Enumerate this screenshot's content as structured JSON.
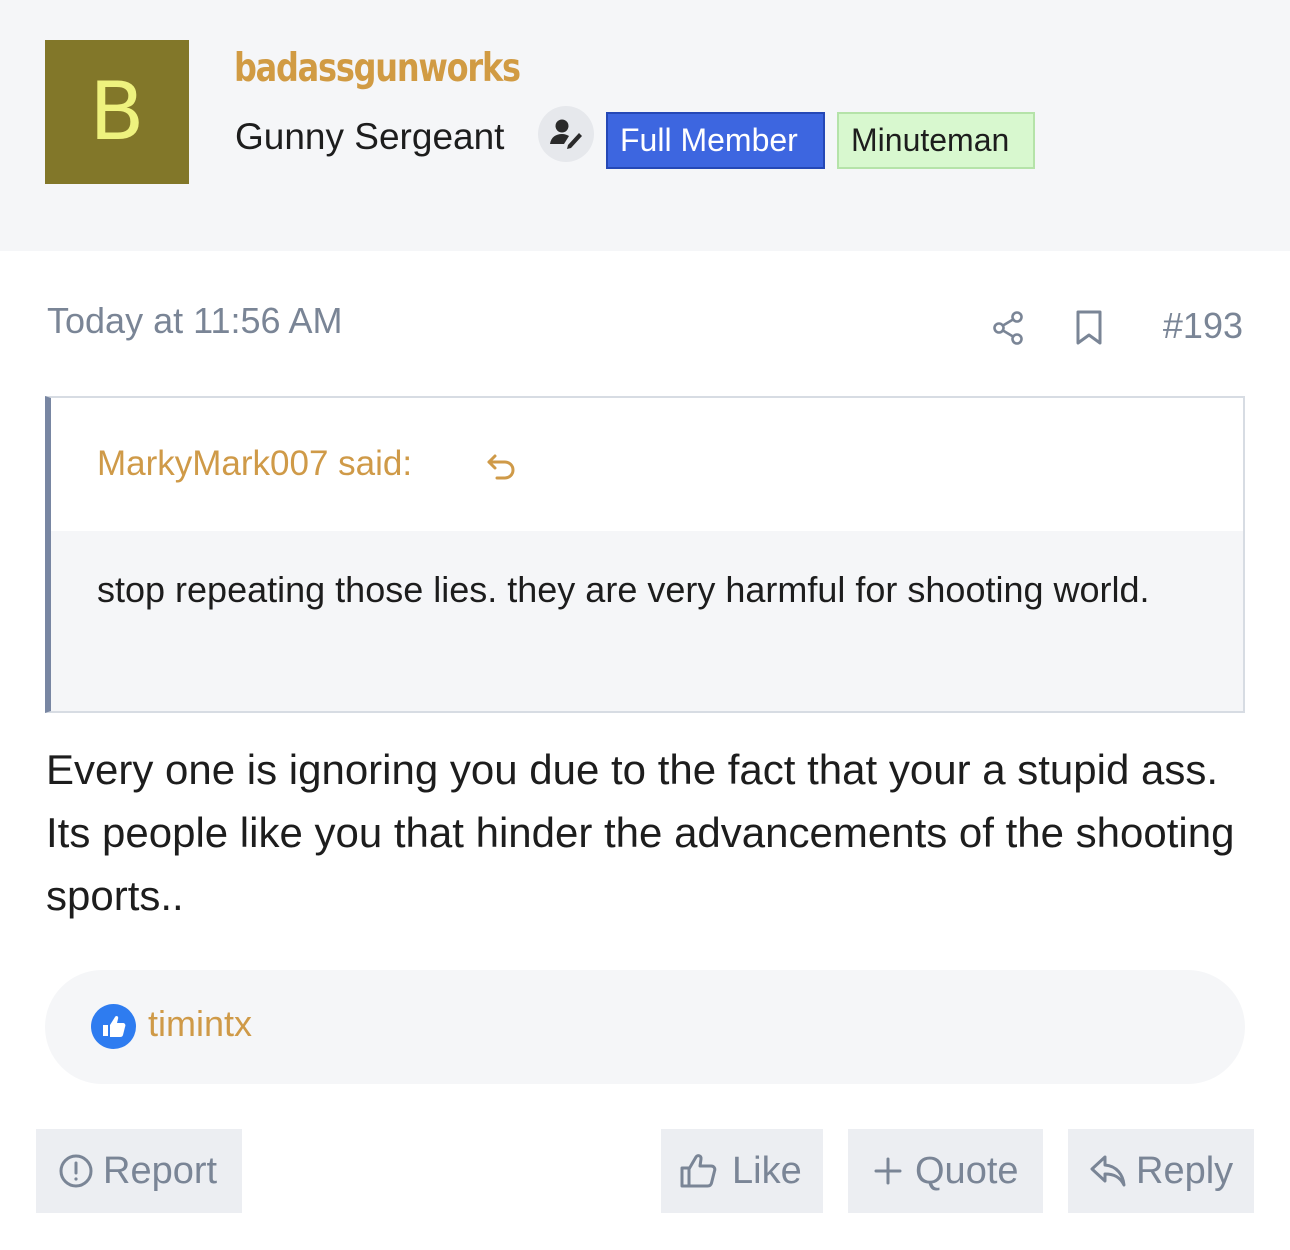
{
  "author": {
    "avatar_letter": "B",
    "avatar_color": "#827729",
    "username": "badassgunworks",
    "rank": "Gunny Sergeant",
    "staff_icon": "user-pen-icon",
    "badges": [
      "Full Member",
      "Minuteman"
    ]
  },
  "post": {
    "date": "Today at 11:56 AM",
    "number": "#193",
    "quote": {
      "author_label": "MarkyMark007 said:",
      "text": "stop repeating those lies. they are very harmful for shooting world."
    },
    "message": "Every one is ignoring you due to the fact that your a stupid ass. Its people like you that hinder the advancements of the shooting sports.."
  },
  "reactions": {
    "icon": "thumbs-up-icon",
    "users": "timintx"
  },
  "actions": {
    "report": "Report",
    "like": "Like",
    "quote": "Quote",
    "reply": "Reply"
  }
}
